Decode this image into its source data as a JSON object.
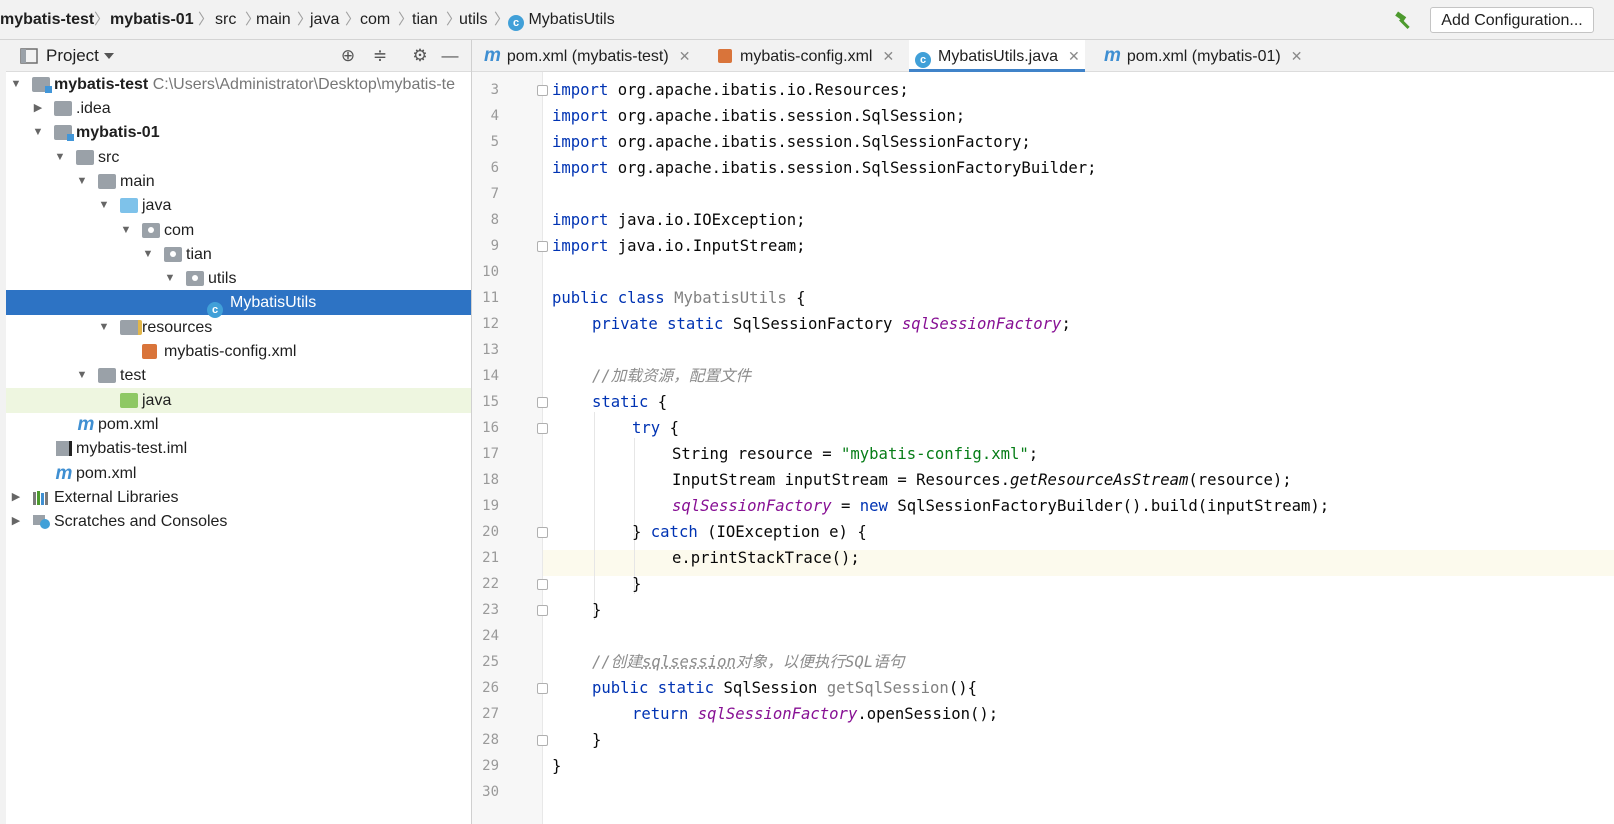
{
  "breadcrumbs": [
    "mybatis-test",
    "mybatis-01",
    "src",
    "main",
    "java",
    "com",
    "tian",
    "utils",
    "MybatisUtils"
  ],
  "toolbar": {
    "add_configuration": "Add Configuration..."
  },
  "project_panel": {
    "title": "Project",
    "tree": [
      {
        "label": "mybatis-test",
        "path": "C:\\Users\\Administrator\\Desktop\\mybatis-te",
        "bold": true,
        "icon": "module-icon"
      },
      {
        "label": ".idea",
        "icon": "folder-icon"
      },
      {
        "label": "mybatis-01",
        "bold": true,
        "icon": "module-icon"
      },
      {
        "label": "src",
        "icon": "folder-icon"
      },
      {
        "label": "main",
        "icon": "folder-icon"
      },
      {
        "label": "java",
        "icon": "source-folder-icon"
      },
      {
        "label": "com",
        "icon": "package-icon"
      },
      {
        "label": "tian",
        "icon": "package-icon"
      },
      {
        "label": "utils",
        "icon": "package-icon"
      },
      {
        "label": "MybatisUtils",
        "icon": "class-icon",
        "selected": true
      },
      {
        "label": "resources",
        "icon": "resources-folder-icon"
      },
      {
        "label": "mybatis-config.xml",
        "icon": "xml-file-icon"
      },
      {
        "label": "test",
        "icon": "folder-icon"
      },
      {
        "label": "java",
        "icon": "test-folder-icon"
      },
      {
        "label": "pom.xml",
        "icon": "maven-icon"
      },
      {
        "label": "mybatis-test.iml",
        "icon": "iml-file-icon"
      },
      {
        "label": "pom.xml",
        "icon": "maven-icon"
      },
      {
        "label": "External Libraries",
        "icon": "libraries-icon"
      },
      {
        "label": "Scratches and Consoles",
        "icon": "scratches-icon"
      }
    ]
  },
  "tabs": [
    {
      "label": "pom.xml (mybatis-test)",
      "icon": "maven-icon"
    },
    {
      "label": "mybatis-config.xml",
      "icon": "xml-file-icon"
    },
    {
      "label": "MybatisUtils.java",
      "icon": "class-icon",
      "active": true
    },
    {
      "label": "pom.xml (mybatis-01)",
      "icon": "maven-icon"
    }
  ],
  "editor": {
    "line_numbers": [
      "3",
      "4",
      "5",
      "6",
      "7",
      "8",
      "9",
      "10",
      "11",
      "12",
      "13",
      "14",
      "15",
      "16",
      "17",
      "18",
      "19",
      "20",
      "21",
      "22",
      "23",
      "24",
      "25",
      "26",
      "27",
      "28",
      "29",
      "30"
    ],
    "current_line": "21",
    "tokens": {
      "import": "import",
      "l3": "org.apache.ibatis.io.Resources;",
      "l4": "org.apache.ibatis.session.SqlSession;",
      "l5": "org.apache.ibatis.session.SqlSessionFactory;",
      "l6": "org.apache.ibatis.session.SqlSessionFactoryBuilder;",
      "l8": "java.io.IOException;",
      "l9": "java.io.InputStream;",
      "public": "public",
      "class": "class",
      "classname": "MybatisUtils",
      "brace_open": "{",
      "brace_close": "}",
      "private": "private",
      "static": "static",
      "factory_type": "SqlSessionFactory",
      "factory_field": "sqlSessionFactory",
      "semicolon": ";",
      "comment1": "//加载资源，配置文件",
      "try": "try",
      "l17a": "String resource = ",
      "l17str": "\"mybatis-config.xml\"",
      "l18a": "InputStream inputStream = Resources.",
      "l18m": "getResourceAsStream",
      "l18b": "(resource);",
      "l19eq": " = ",
      "new": "new",
      "l19b": " SqlSessionFactoryBuilder().build(inputStream);",
      "catch": "catch",
      "l20b": " (IOException e) {",
      "l21": "e.printStackTrace();",
      "comment2a": "//创建",
      "comment2b": "sqlsession",
      "comment2c": "对象，以便执行SQL语句",
      "session_type": "SqlSession",
      "getter": "getSqlSession",
      "getter_tail": "(){",
      "return": "return",
      "l27b": ".openSession();"
    }
  },
  "colors": {
    "keyword": "#0033b3",
    "field": "#871094",
    "string": "#067d17",
    "comment": "#8c8c8c",
    "selection": "#2d73c4"
  }
}
